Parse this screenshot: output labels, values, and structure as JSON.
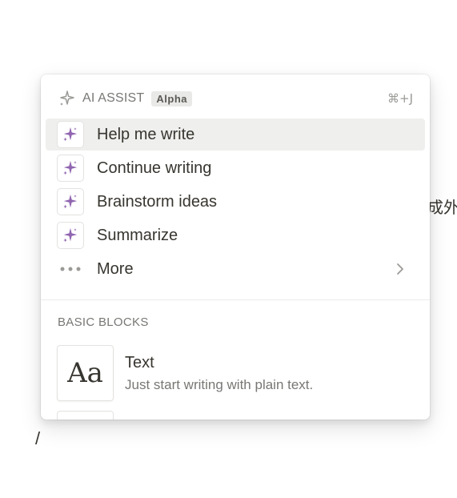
{
  "background": {
    "partial_text": "成外在",
    "slash": "/"
  },
  "menu": {
    "ai_assist": {
      "title": "AI ASSIST",
      "badge": "Alpha",
      "shortcut": "⌘+J"
    },
    "ai_items": [
      {
        "label": "Help me write",
        "icon": "sparkle-icon",
        "selected": true
      },
      {
        "label": "Continue writing",
        "icon": "sparkle-icon",
        "selected": false
      },
      {
        "label": "Brainstorm ideas",
        "icon": "sparkle-icon",
        "selected": false
      },
      {
        "label": "Summarize",
        "icon": "sparkle-icon",
        "selected": false
      }
    ],
    "more": {
      "label": "More",
      "icon": "more-dots-icon"
    },
    "basic_blocks": {
      "section_title": "BASIC BLOCKS",
      "items": [
        {
          "thumb": "Aa",
          "title": "Text",
          "description": "Just start writing with plain text."
        }
      ]
    }
  },
  "colors": {
    "sparkle_purple": "#9065b0",
    "text_primary": "#37352f",
    "text_secondary": "#787774",
    "selected_bg": "#efefee"
  }
}
